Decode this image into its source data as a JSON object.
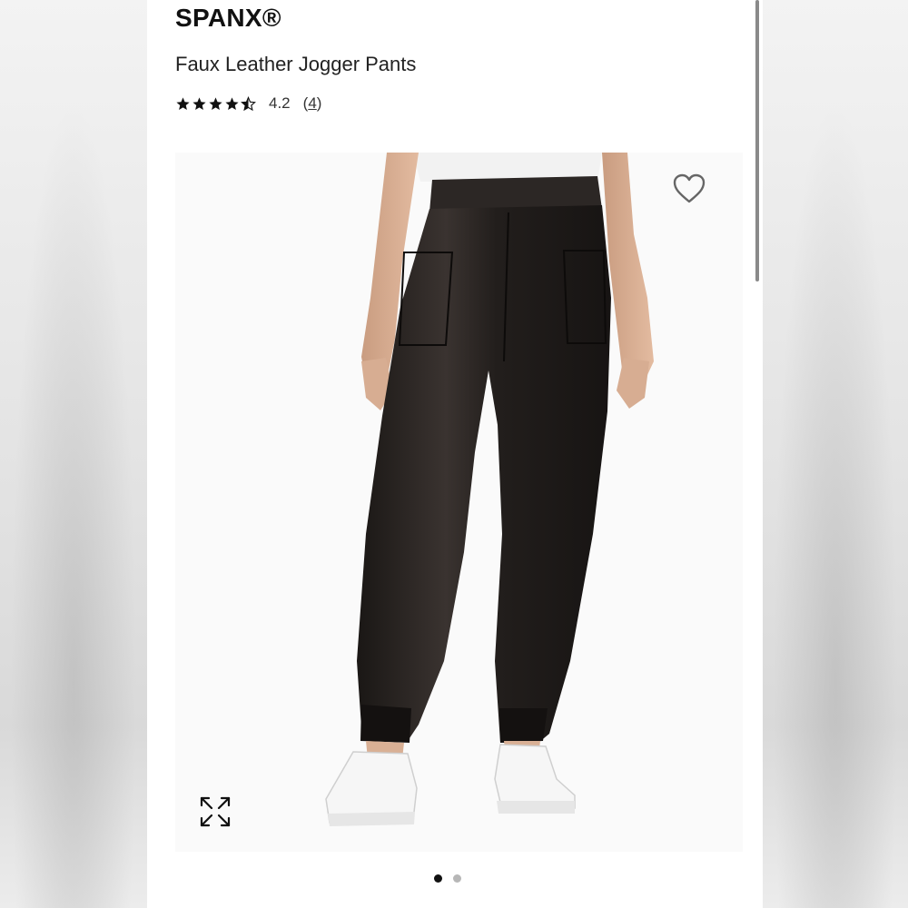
{
  "product": {
    "brand": "SPANX®",
    "title": "Faux Leather Jogger Pants",
    "rating": {
      "stars": 4.2,
      "max_stars": 5,
      "value_text": "4.2",
      "open_paren": "(",
      "count": "4",
      "close_paren": ")"
    }
  },
  "gallery": {
    "image": "black faux leather jogger pants worn with white sneakers",
    "current_index": 1,
    "total": 2
  },
  "icons": {
    "favorite": "heart-outline-icon",
    "fullscreen": "expand-arrows-icon",
    "star": "star-icon"
  },
  "colors": {
    "text": "#111111",
    "dot_active": "#111111",
    "dot_inactive": "#b7b7b7"
  }
}
